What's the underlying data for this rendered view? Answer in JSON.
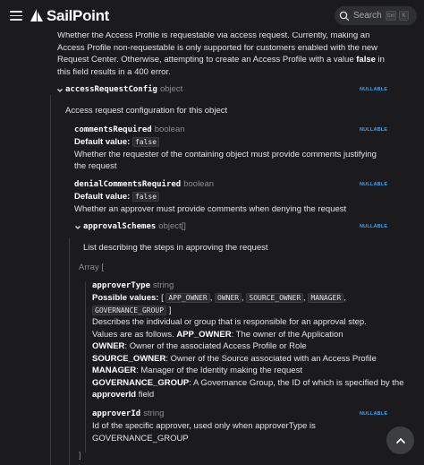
{
  "header": {
    "brand": "SailPoint",
    "search_label": "Search",
    "shortcut_keys": [
      "Ctrl",
      "K"
    ]
  },
  "intro_lines": [
    "Whether the Access Profile is requestable via access request. Currently, making an",
    "Access Profile non-requestable is only supported for customers enabled with the new",
    "Request Center. Otherwise, attempting to create an Access Profile with a value",
    "this field results in a 400 error."
  ],
  "intro_bold": "false",
  "intro_after_bold": " in",
  "accessRequestConfig": {
    "name": "accessRequestConfig",
    "type": "object",
    "nullable": "NULLABLE",
    "description": "Access request configuration for this object"
  },
  "commentsRequired": {
    "name": "commentsRequired",
    "type": "boolean",
    "nullable": "NULLABLE",
    "default_label": "Default value:",
    "default_value": "false",
    "desc_lines": [
      "Whether the requester of the containing object must provide comments justifying",
      "the request"
    ]
  },
  "denialCommentsRequired": {
    "name": "denialCommentsRequired",
    "type": "boolean",
    "nullable": "NULLABLE",
    "default_label": "Default value:",
    "default_value": "false",
    "description": "Whether an approver must provide comments when denying the request"
  },
  "approvalSchemes": {
    "name": "approvalSchemes",
    "type": "object[]",
    "nullable": "NULLABLE",
    "description": "List describing the steps in approving the request",
    "array_open": "Array [",
    "array_close": "]"
  },
  "approverType": {
    "name": "approverType",
    "type": "string",
    "possible_label": "Possible values:",
    "values": [
      "APP_OWNER",
      "OWNER",
      "SOURCE_OWNER",
      "MANAGER",
      "GOVERNANCE_GROUP"
    ],
    "desc_line1": "Describes the individual or group that is responsible for an approval step.",
    "desc_line2_pre": "Values are as follows. ",
    "items": [
      {
        "key": "APP_OWNER",
        "text": ": The owner of the Application"
      },
      {
        "key": "OWNER",
        "text": ": Owner of the associated Access Profile or Role"
      },
      {
        "key": "SOURCE_OWNER",
        "text": ": Owner of the Source associated with an Access Profile"
      },
      {
        "key": "MANAGER",
        "text": ": Manager of the Identity making the request"
      },
      {
        "key": "GOVERNANCE_GROUP",
        "text": ": A Governance Group, the ID of which is specified by the"
      }
    ],
    "last_key": "approverId",
    "last_text": " field"
  },
  "approverId": {
    "name": "approverId",
    "type": "string",
    "nullable": "NULLABLE",
    "desc_lines": [
      "Id of the specific approver, used only when approverType is",
      "GOVERNANCE_GROUP"
    ]
  }
}
